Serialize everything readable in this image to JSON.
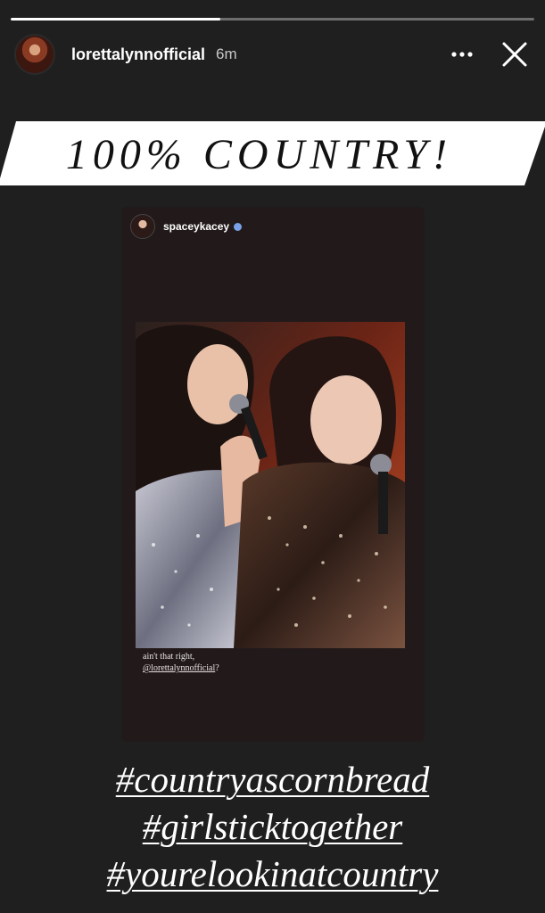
{
  "story": {
    "progress": 0.4,
    "username": "lorettalynnofficial",
    "timestamp": "6m",
    "more_icon": "more-horizontal-icon",
    "close_icon": "close-icon"
  },
  "banner": {
    "text": "100% COUNTRY!",
    "background_color": "#ffffff",
    "text_color": "#111111"
  },
  "shared_post": {
    "username": "spaceykacey",
    "verified_icon": "verified-badge-icon",
    "caption_line1": "ain't that right,",
    "caption_mention": "@lorettalynnofficial",
    "caption_suffix": "?"
  },
  "hashtags": [
    "#countryascornbread",
    "#girlsticktogether",
    "#yourelookinatcountry"
  ],
  "colors": {
    "background": "#1f1f1f",
    "card_background": "#221a1a",
    "text": "#ffffff"
  }
}
